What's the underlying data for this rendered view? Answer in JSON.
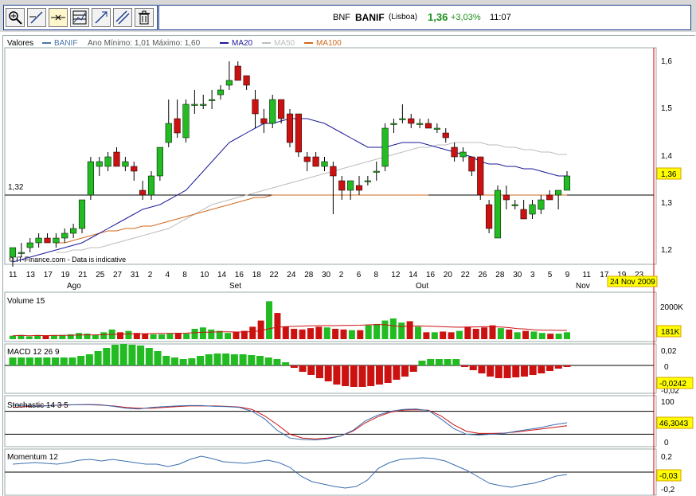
{
  "toolbar": {
    "tools": [
      "zoom-icon",
      "draw-line-icon",
      "crosshair-icon",
      "indicator-icon",
      "trend-line-icon",
      "parallel-line-icon",
      "trash-icon"
    ]
  },
  "ticker": {
    "symbol": "BNF",
    "name": "BANIF",
    "exchange": "(Lisboa)",
    "price": "1,36",
    "change": "+3,03%",
    "time": "11:07",
    "up_color": "#1a8f1a"
  },
  "legend": {
    "values_label": "Valores",
    "series_name": "BANIF",
    "range_text": "Ano Mínimo: 1,01 Máximo: 1,60",
    "ma20": "MA20",
    "ma50": "MA50",
    "ma100": "MA100",
    "colors": {
      "series": "#4a76a8",
      "ma20": "#1a1a9a",
      "ma50": "#bdbdbd",
      "ma100": "#d2691e"
    }
  },
  "price_panel": {
    "ref_label": "1,32",
    "ref_value": 1.32,
    "current_label": "1,36",
    "copyright": "© IT-Finance.com - Data is indicative",
    "date_label": "24 Nov 2009",
    "y_ticks": [
      "1,6",
      "1,5",
      "1,4",
      "1,3",
      "1,2"
    ]
  },
  "x_axis": {
    "day_labels": [
      "11",
      "13",
      "17",
      "19",
      "21",
      "25",
      "27",
      "31",
      "2",
      "4",
      "8",
      "10",
      "14",
      "16",
      "18",
      "22",
      "24",
      "28",
      "30",
      "2",
      "6",
      "8",
      "12",
      "14",
      "16",
      "20",
      "22",
      "26",
      "28",
      "30",
      "3",
      "5",
      "9",
      "11",
      "17",
      "19",
      "23"
    ],
    "month_labels": [
      "Ago",
      "Set",
      "Out",
      "Nov"
    ]
  },
  "volume_panel": {
    "title": "Volume 15",
    "scale_label": "2000K",
    "current_label": "181K"
  },
  "macd_panel": {
    "title": "MACD 12 26 9",
    "ticks": [
      "0,02",
      "0",
      "-0,02"
    ],
    "current_label": "-0,0242"
  },
  "stoch_panel": {
    "title": "Stochastic 14 3 5",
    "ticks": [
      "100",
      "0"
    ],
    "current_label": "46,3043"
  },
  "momentum_panel": {
    "title": "Momentum 12",
    "ticks": [
      "0,2",
      "-0,2"
    ],
    "current_label": "-0,03"
  },
  "chart_data": {
    "type": "candlestick",
    "ylim": [
      1.18,
      1.62
    ],
    "candles": [
      {
        "o": 1.19,
        "h": 1.21,
        "l": 1.17,
        "c": 1.21
      },
      {
        "o": 1.2,
        "h": 1.22,
        "l": 1.19,
        "c": 1.2
      },
      {
        "o": 1.21,
        "h": 1.23,
        "l": 1.2,
        "c": 1.22
      },
      {
        "o": 1.22,
        "h": 1.24,
        "l": 1.21,
        "c": 1.23
      },
      {
        "o": 1.23,
        "h": 1.24,
        "l": 1.22,
        "c": 1.22
      },
      {
        "o": 1.22,
        "h": 1.24,
        "l": 1.21,
        "c": 1.23
      },
      {
        "o": 1.23,
        "h": 1.25,
        "l": 1.22,
        "c": 1.24
      },
      {
        "o": 1.24,
        "h": 1.26,
        "l": 1.23,
        "c": 1.25
      },
      {
        "o": 1.25,
        "h": 1.31,
        "l": 1.24,
        "c": 1.31
      },
      {
        "o": 1.32,
        "h": 1.4,
        "l": 1.31,
        "c": 1.39
      },
      {
        "o": 1.38,
        "h": 1.4,
        "l": 1.36,
        "c": 1.39
      },
      {
        "o": 1.38,
        "h": 1.41,
        "l": 1.37,
        "c": 1.4
      },
      {
        "o": 1.41,
        "h": 1.42,
        "l": 1.38,
        "c": 1.38
      },
      {
        "o": 1.38,
        "h": 1.4,
        "l": 1.37,
        "c": 1.39
      },
      {
        "o": 1.38,
        "h": 1.39,
        "l": 1.35,
        "c": 1.37
      },
      {
        "o": 1.33,
        "h": 1.35,
        "l": 1.31,
        "c": 1.32
      },
      {
        "o": 1.32,
        "h": 1.37,
        "l": 1.31,
        "c": 1.36
      },
      {
        "o": 1.36,
        "h": 1.42,
        "l": 1.35,
        "c": 1.42
      },
      {
        "o": 1.43,
        "h": 1.52,
        "l": 1.42,
        "c": 1.47
      },
      {
        "o": 1.48,
        "h": 1.52,
        "l": 1.44,
        "c": 1.45
      },
      {
        "o": 1.44,
        "h": 1.52,
        "l": 1.43,
        "c": 1.51
      },
      {
        "o": 1.51,
        "h": 1.54,
        "l": 1.49,
        "c": 1.51
      },
      {
        "o": 1.51,
        "h": 1.53,
        "l": 1.5,
        "c": 1.51
      },
      {
        "o": 1.52,
        "h": 1.54,
        "l": 1.5,
        "c": 1.52
      },
      {
        "o": 1.53,
        "h": 1.55,
        "l": 1.52,
        "c": 1.54
      },
      {
        "o": 1.55,
        "h": 1.6,
        "l": 1.54,
        "c": 1.56
      },
      {
        "o": 1.59,
        "h": 1.6,
        "l": 1.56,
        "c": 1.56
      },
      {
        "o": 1.57,
        "h": 1.57,
        "l": 1.54,
        "c": 1.55
      },
      {
        "o": 1.52,
        "h": 1.54,
        "l": 1.46,
        "c": 1.49
      },
      {
        "o": 1.48,
        "h": 1.5,
        "l": 1.45,
        "c": 1.47
      },
      {
        "o": 1.47,
        "h": 1.53,
        "l": 1.46,
        "c": 1.52
      },
      {
        "o": 1.52,
        "h": 1.52,
        "l": 1.47,
        "c": 1.48
      },
      {
        "o": 1.49,
        "h": 1.5,
        "l": 1.42,
        "c": 1.43
      },
      {
        "o": 1.49,
        "h": 1.49,
        "l": 1.4,
        "c": 1.41
      },
      {
        "o": 1.4,
        "h": 1.41,
        "l": 1.37,
        "c": 1.39
      },
      {
        "o": 1.4,
        "h": 1.41,
        "l": 1.38,
        "c": 1.38
      },
      {
        "o": 1.38,
        "h": 1.4,
        "l": 1.37,
        "c": 1.39
      },
      {
        "o": 1.38,
        "h": 1.39,
        "l": 1.28,
        "c": 1.36
      },
      {
        "o": 1.35,
        "h": 1.36,
        "l": 1.31,
        "c": 1.33
      },
      {
        "o": 1.33,
        "h": 1.35,
        "l": 1.31,
        "c": 1.35
      },
      {
        "o": 1.34,
        "h": 1.36,
        "l": 1.32,
        "c": 1.33
      },
      {
        "o": 1.35,
        "h": 1.36,
        "l": 1.34,
        "c": 1.35
      },
      {
        "o": 1.37,
        "h": 1.39,
        "l": 1.35,
        "c": 1.37
      },
      {
        "o": 1.38,
        "h": 1.47,
        "l": 1.37,
        "c": 1.46
      },
      {
        "o": 1.47,
        "h": 1.48,
        "l": 1.45,
        "c": 1.47
      },
      {
        "o": 1.48,
        "h": 1.51,
        "l": 1.47,
        "c": 1.48
      },
      {
        "o": 1.48,
        "h": 1.49,
        "l": 1.46,
        "c": 1.47
      },
      {
        "o": 1.47,
        "h": 1.48,
        "l": 1.46,
        "c": 1.47
      },
      {
        "o": 1.47,
        "h": 1.48,
        "l": 1.46,
        "c": 1.46
      },
      {
        "o": 1.46,
        "h": 1.47,
        "l": 1.45,
        "c": 1.46
      },
      {
        "o": 1.45,
        "h": 1.46,
        "l": 1.43,
        "c": 1.44
      },
      {
        "o": 1.42,
        "h": 1.43,
        "l": 1.39,
        "c": 1.4
      },
      {
        "o": 1.4,
        "h": 1.42,
        "l": 1.39,
        "c": 1.41
      },
      {
        "o": 1.4,
        "h": 1.4,
        "l": 1.36,
        "c": 1.37
      },
      {
        "o": 1.4,
        "h": 1.4,
        "l": 1.31,
        "c": 1.32
      },
      {
        "o": 1.3,
        "h": 1.31,
        "l": 1.24,
        "c": 1.25
      },
      {
        "o": 1.23,
        "h": 1.34,
        "l": 1.23,
        "c": 1.33
      },
      {
        "o": 1.32,
        "h": 1.34,
        "l": 1.29,
        "c": 1.31
      },
      {
        "o": 1.3,
        "h": 1.31,
        "l": 1.29,
        "c": 1.3
      },
      {
        "o": 1.29,
        "h": 1.31,
        "l": 1.27,
        "c": 1.27
      },
      {
        "o": 1.28,
        "h": 1.31,
        "l": 1.27,
        "c": 1.3
      },
      {
        "o": 1.29,
        "h": 1.32,
        "l": 1.28,
        "c": 1.31
      },
      {
        "o": 1.32,
        "h": 1.33,
        "l": 1.31,
        "c": 1.31
      },
      {
        "o": 1.32,
        "h": 1.33,
        "l": 1.29,
        "c": 1.33
      },
      {
        "o": 1.33,
        "h": 1.37,
        "l": 1.33,
        "c": 1.36
      }
    ],
    "ma20": [
      1.18,
      1.185,
      1.19,
      1.195,
      1.2,
      1.205,
      1.21,
      1.215,
      1.22,
      1.23,
      1.24,
      1.25,
      1.26,
      1.27,
      1.28,
      1.29,
      1.295,
      1.3,
      1.31,
      1.32,
      1.33,
      1.35,
      1.37,
      1.39,
      1.41,
      1.43,
      1.44,
      1.45,
      1.46,
      1.47,
      1.47,
      1.475,
      1.48,
      1.48,
      1.48,
      1.475,
      1.47,
      1.46,
      1.45,
      1.44,
      1.43,
      1.42,
      1.42,
      1.42,
      1.425,
      1.43,
      1.43,
      1.43,
      1.425,
      1.42,
      1.415,
      1.41,
      1.405,
      1.4,
      1.39,
      1.385,
      1.385,
      1.38,
      1.38,
      1.375,
      1.375,
      1.37,
      1.365,
      1.36,
      1.36
    ],
    "ma50": [
      null,
      null,
      null,
      null,
      null,
      1.2,
      1.2,
      1.205,
      1.205,
      1.21,
      1.21,
      1.215,
      1.22,
      1.225,
      1.23,
      1.235,
      1.24,
      1.245,
      1.25,
      1.26,
      1.27,
      1.28,
      1.29,
      1.3,
      1.305,
      1.31,
      1.315,
      1.32,
      1.325,
      1.33,
      1.335,
      1.34,
      1.345,
      1.35,
      1.355,
      1.36,
      1.365,
      1.37,
      1.375,
      1.38,
      1.385,
      1.39,
      1.395,
      1.4,
      1.405,
      1.41,
      1.415,
      1.42,
      1.42,
      1.425,
      1.425,
      1.43,
      1.43,
      1.43,
      1.43,
      1.425,
      1.425,
      1.42,
      1.42,
      1.415,
      1.415,
      1.41,
      1.41,
      1.405,
      1.405
    ],
    "ma100": [
      null,
      null,
      null,
      null,
      null,
      1.22,
      1.22,
      1.225,
      1.23,
      1.235,
      1.24,
      1.245,
      1.245,
      1.25,
      1.25,
      1.255,
      1.255,
      1.26,
      1.265,
      1.27,
      1.275,
      1.28,
      1.285,
      1.29,
      1.295,
      1.3,
      1.305,
      1.31,
      1.315,
      1.315,
      1.32,
      1.32,
      1.32,
      1.32,
      1.32,
      1.32,
      1.32,
      1.32,
      1.32,
      1.32,
      1.32,
      1.32,
      1.32,
      1.32,
      1.32,
      1.32,
      1.32,
      1.32,
      1.32,
      null,
      null,
      null,
      null,
      null,
      1.32,
      1.32,
      1.32,
      1.32,
      1.32,
      1.32,
      1.32,
      1.32,
      1.32,
      1.32,
      1.32
    ],
    "volume": [
      5,
      6,
      4,
      6,
      5,
      6,
      6,
      7,
      9,
      8,
      6,
      10,
      14,
      10,
      12,
      9,
      8,
      7,
      7,
      8,
      9,
      8,
      15,
      17,
      14,
      12,
      9,
      11,
      12,
      18,
      27,
      55,
      38,
      18,
      15,
      14,
      16,
      18,
      17,
      15,
      14,
      13,
      13,
      20,
      22,
      27,
      30,
      24,
      26,
      18,
      10,
      10,
      11,
      10,
      12,
      18,
      15,
      17,
      20,
      16,
      14,
      10,
      12,
      11,
      9,
      8,
      8,
      10
    ],
    "macd": [
      0.01,
      0.01,
      0.01,
      0.01,
      0.01,
      0.01,
      0.01,
      0.01,
      0.012,
      0.014,
      0.018,
      0.022,
      0.026,
      0.027,
      0.026,
      0.025,
      0.022,
      0.018,
      0.012,
      0.01,
      0.008,
      0.009,
      0.012,
      0.014,
      0.015,
      0.015,
      0.014,
      0.014,
      0.013,
      0.012,
      0.01,
      0.008,
      0.004,
      -0.003,
      -0.008,
      -0.012,
      -0.016,
      -0.02,
      -0.024,
      -0.026,
      -0.027,
      -0.027,
      -0.026,
      -0.024,
      -0.022,
      -0.018,
      -0.014,
      -0.008,
      0.006,
      0.008,
      0.008,
      0.008,
      0.008,
      -0.002,
      -0.006,
      -0.01,
      -0.014,
      -0.016,
      -0.016,
      -0.015,
      -0.014,
      -0.012,
      -0.01,
      -0.007,
      -0.004,
      -0.002
    ],
    "stoch_k": [
      96,
      95,
      93,
      95,
      97,
      97,
      98,
      97,
      93,
      88,
      86,
      90,
      92,
      94,
      95,
      95,
      93,
      92,
      90,
      80,
      60,
      30,
      10,
      6,
      5,
      8,
      15,
      30,
      55,
      70,
      80,
      85,
      86,
      82,
      60,
      35,
      20,
      18,
      20,
      22,
      28,
      33,
      38,
      45,
      50
    ],
    "stoch_d": [
      90,
      92,
      94,
      95,
      96,
      97,
      97,
      96,
      94,
      90,
      88,
      88,
      90,
      92,
      94,
      94,
      94,
      93,
      91,
      85,
      68,
      45,
      20,
      10,
      8,
      10,
      15,
      28,
      50,
      66,
      78,
      83,
      84,
      83,
      68,
      45,
      28,
      22,
      22,
      23,
      26,
      30,
      34,
      38,
      42
    ],
    "momentum": [
      0.1,
      0.11,
      0.12,
      0.11,
      0.1,
      0.12,
      0.15,
      0.16,
      0.14,
      0.16,
      0.14,
      0.12,
      0.1,
      0.1,
      0.07,
      0.1,
      0.16,
      0.2,
      0.17,
      0.13,
      0.12,
      0.11,
      0.13,
      0.15,
      0.12,
      0.06,
      -0.05,
      -0.12,
      -0.15,
      -0.18,
      -0.2,
      -0.18,
      -0.1,
      0.05,
      0.12,
      0.16,
      0.17,
      0.18,
      0.17,
      0.14,
      0.08,
      0.02,
      -0.06,
      -0.14,
      -0.17,
      -0.19,
      -0.16,
      -0.14,
      -0.1,
      -0.05,
      -0.03
    ]
  }
}
